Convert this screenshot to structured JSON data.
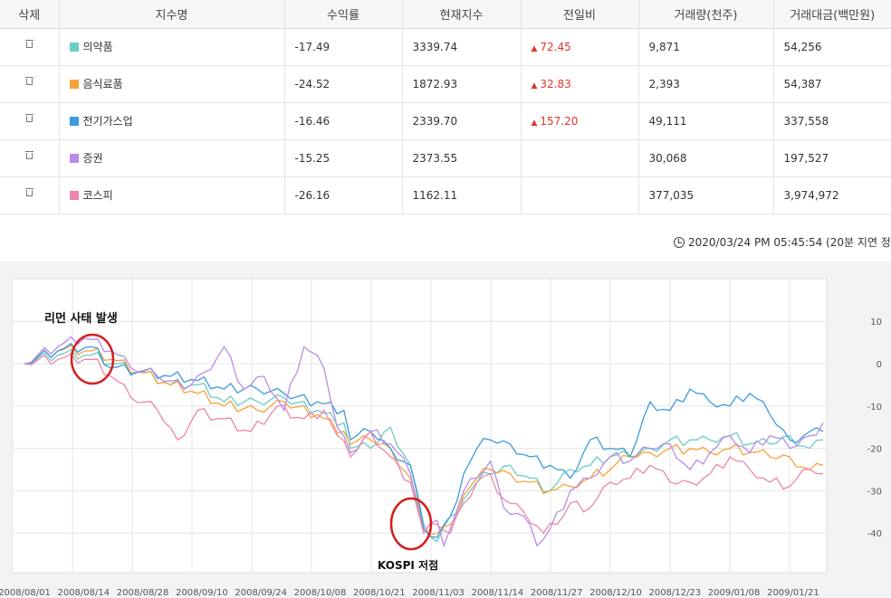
{
  "table": {
    "headers": [
      "삭제",
      "지수명",
      "수익률",
      "현재지수",
      "전일비",
      "거래량(천주)",
      "거래대금(백만원)"
    ],
    "rows": [
      {
        "name": "의약품",
        "color": "#6ccdc3",
        "return": "-17.49",
        "current": "3339.74",
        "change": "72.45",
        "change_dir": "up",
        "volume": "9,871",
        "amount": "54,256"
      },
      {
        "name": "음식료품",
        "color": "#f7a23a",
        "return": "-24.52",
        "current": "1872.93",
        "change": "32.83",
        "change_dir": "up",
        "volume": "2,393",
        "amount": "54,387"
      },
      {
        "name": "전기가스업",
        "color": "#3c9ae0",
        "return": "-16.46",
        "current": "2339.70",
        "change": "157.20",
        "change_dir": "up",
        "volume": "49,111",
        "amount": "337,558"
      },
      {
        "name": "증권",
        "color": "#b98be8",
        "return": "-15.25",
        "current": "2373.55",
        "change": "",
        "change_dir": "",
        "volume": "30,068",
        "amount": "197,527"
      },
      {
        "name": "코스피",
        "color": "#ee84ad",
        "return": "-26.16",
        "current": "1162.11",
        "change": "",
        "change_dir": "",
        "volume": "377,035",
        "amount": "3,974,972"
      }
    ]
  },
  "timestamp": "2020/03/24 PM 05:45:54 (20분 지연 정",
  "annotations": {
    "lehman": "리먼 사태 발생",
    "kospi_low": "KOSPI 저점"
  },
  "chart_data": {
    "type": "line",
    "x_ticks": [
      "2008/08/01",
      "2008/08/14",
      "2008/08/28",
      "2008/09/10",
      "2008/09/24",
      "2008/10/08",
      "2008/10/21",
      "2008/11/03",
      "2008/11/14",
      "2008/11/27",
      "2008/12/10",
      "2008/12/23",
      "2009/01/08",
      "2009/01/21"
    ],
    "y_ticks": [
      10,
      0,
      -10,
      -20,
      -30,
      -40
    ],
    "ylim": [
      -45,
      12
    ],
    "grid": true,
    "points_per_series": 121,
    "series": [
      {
        "name": "의약품",
        "color": "#6ccdc3",
        "keys": [
          [
            0,
            0
          ],
          [
            5,
            2
          ],
          [
            10,
            2
          ],
          [
            13,
            0
          ],
          [
            17,
            -2
          ],
          [
            22,
            -5
          ],
          [
            26,
            -5
          ],
          [
            30,
            -9
          ],
          [
            35,
            -9
          ],
          [
            39,
            -8
          ],
          [
            44,
            -11
          ],
          [
            48,
            -14
          ],
          [
            49,
            -20
          ],
          [
            52,
            -20
          ],
          [
            55,
            -15
          ],
          [
            58,
            -24
          ],
          [
            60,
            -38
          ],
          [
            62,
            -42
          ],
          [
            64,
            -36
          ],
          [
            66,
            -32
          ],
          [
            68,
            -28
          ],
          [
            70,
            -26
          ],
          [
            73,
            -24
          ],
          [
            76,
            -27
          ],
          [
            79,
            -30
          ],
          [
            82,
            -25
          ],
          [
            85,
            -24
          ],
          [
            88,
            -22
          ],
          [
            91,
            -22
          ],
          [
            94,
            -20
          ],
          [
            97,
            -18
          ],
          [
            100,
            -18
          ],
          [
            103,
            -18
          ],
          [
            106,
            -17
          ],
          [
            109,
            -19
          ],
          [
            112,
            -19
          ],
          [
            115,
            -17
          ],
          [
            118,
            -20
          ],
          [
            120,
            -18
          ]
        ]
      },
      {
        "name": "음식료품",
        "color": "#f7a23a",
        "keys": [
          [
            0,
            0
          ],
          [
            5,
            3
          ],
          [
            10,
            3
          ],
          [
            13,
            1
          ],
          [
            17,
            -2
          ],
          [
            22,
            -5
          ],
          [
            26,
            -7
          ],
          [
            30,
            -10
          ],
          [
            35,
            -11
          ],
          [
            39,
            -9
          ],
          [
            44,
            -12
          ],
          [
            48,
            -16
          ],
          [
            49,
            -19
          ],
          [
            52,
            -18
          ],
          [
            55,
            -20
          ],
          [
            58,
            -27
          ],
          [
            60,
            -39
          ],
          [
            62,
            -40
          ],
          [
            64,
            -38
          ],
          [
            66,
            -31
          ],
          [
            68,
            -27
          ],
          [
            70,
            -25
          ],
          [
            73,
            -26
          ],
          [
            76,
            -28
          ],
          [
            79,
            -30
          ],
          [
            82,
            -29
          ],
          [
            85,
            -27
          ],
          [
            88,
            -25
          ],
          [
            91,
            -22
          ],
          [
            94,
            -21
          ],
          [
            97,
            -20
          ],
          [
            100,
            -20
          ],
          [
            103,
            -21
          ],
          [
            106,
            -20
          ],
          [
            109,
            -21
          ],
          [
            112,
            -22
          ],
          [
            115,
            -22
          ],
          [
            118,
            -25
          ],
          [
            120,
            -24
          ]
        ]
      },
      {
        "name": "전기가스업",
        "color": "#3c9ae0",
        "keys": [
          [
            0,
            0
          ],
          [
            5,
            3
          ],
          [
            10,
            4
          ],
          [
            13,
            -1
          ],
          [
            17,
            -2
          ],
          [
            22,
            -3
          ],
          [
            26,
            -4
          ],
          [
            30,
            -6
          ],
          [
            35,
            -6
          ],
          [
            39,
            -7
          ],
          [
            44,
            -9
          ],
          [
            48,
            -11
          ],
          [
            49,
            -18
          ],
          [
            52,
            -16
          ],
          [
            55,
            -20
          ],
          [
            58,
            -24
          ],
          [
            60,
            -39
          ],
          [
            62,
            -41
          ],
          [
            64,
            -36
          ],
          [
            66,
            -26
          ],
          [
            68,
            -20
          ],
          [
            70,
            -18
          ],
          [
            73,
            -19
          ],
          [
            76,
            -22
          ],
          [
            79,
            -24
          ],
          [
            82,
            -27
          ],
          [
            85,
            -18
          ],
          [
            88,
            -20
          ],
          [
            91,
            -22
          ],
          [
            94,
            -9
          ],
          [
            97,
            -11
          ],
          [
            100,
            -6
          ],
          [
            103,
            -9
          ],
          [
            106,
            -10
          ],
          [
            109,
            -7
          ],
          [
            112,
            -12
          ],
          [
            115,
            -18
          ],
          [
            118,
            -16
          ],
          [
            120,
            -16
          ]
        ]
      },
      {
        "name": "증권",
        "color": "#b98be8",
        "keys": [
          [
            0,
            0
          ],
          [
            5,
            4
          ],
          [
            9,
            6
          ],
          [
            13,
            3
          ],
          [
            16,
            -1
          ],
          [
            20,
            -3
          ],
          [
            24,
            -6
          ],
          [
            27,
            -2
          ],
          [
            30,
            4
          ],
          [
            33,
            -6
          ],
          [
            36,
            -3
          ],
          [
            39,
            -11
          ],
          [
            42,
            4
          ],
          [
            45,
            -1
          ],
          [
            47,
            -15
          ],
          [
            49,
            -21
          ],
          [
            52,
            -16
          ],
          [
            55,
            -19
          ],
          [
            58,
            -26
          ],
          [
            60,
            -40
          ],
          [
            62,
            -37
          ],
          [
            63,
            -43
          ],
          [
            64,
            -39
          ],
          [
            66,
            -30
          ],
          [
            68,
            -27
          ],
          [
            70,
            -23
          ],
          [
            72,
            -34
          ],
          [
            75,
            -36
          ],
          [
            77,
            -43
          ],
          [
            79,
            -39
          ],
          [
            82,
            -30
          ],
          [
            85,
            -27
          ],
          [
            88,
            -22
          ],
          [
            91,
            -23
          ],
          [
            94,
            -20
          ],
          [
            97,
            -19
          ],
          [
            100,
            -25
          ],
          [
            103,
            -21
          ],
          [
            106,
            -17
          ],
          [
            109,
            -21
          ],
          [
            112,
            -17
          ],
          [
            115,
            -20
          ],
          [
            118,
            -17
          ],
          [
            120,
            -14
          ]
        ]
      },
      {
        "name": "코스피",
        "color": "#ee84ad",
        "keys": [
          [
            0,
            0
          ],
          [
            5,
            1
          ],
          [
            10,
            1
          ],
          [
            13,
            -3
          ],
          [
            16,
            -8
          ],
          [
            20,
            -11
          ],
          [
            23,
            -18
          ],
          [
            26,
            -11
          ],
          [
            30,
            -13
          ],
          [
            34,
            -16
          ],
          [
            38,
            -10
          ],
          [
            42,
            -13
          ],
          [
            45,
            -11
          ],
          [
            47,
            -17
          ],
          [
            49,
            -22
          ],
          [
            52,
            -16
          ],
          [
            55,
            -22
          ],
          [
            58,
            -28
          ],
          [
            60,
            -40
          ],
          [
            62,
            -38
          ],
          [
            64,
            -40
          ],
          [
            66,
            -33
          ],
          [
            68,
            -28
          ],
          [
            70,
            -26
          ],
          [
            72,
            -32
          ],
          [
            75,
            -35
          ],
          [
            78,
            -40
          ],
          [
            80,
            -38
          ],
          [
            82,
            -33
          ],
          [
            85,
            -34
          ],
          [
            88,
            -28
          ],
          [
            91,
            -27
          ],
          [
            94,
            -24
          ],
          [
            97,
            -28
          ],
          [
            100,
            -28
          ],
          [
            103,
            -26
          ],
          [
            106,
            -22
          ],
          [
            109,
            -25
          ],
          [
            112,
            -28
          ],
          [
            115,
            -29
          ],
          [
            118,
            -25
          ],
          [
            120,
            -26
          ]
        ]
      }
    ]
  }
}
